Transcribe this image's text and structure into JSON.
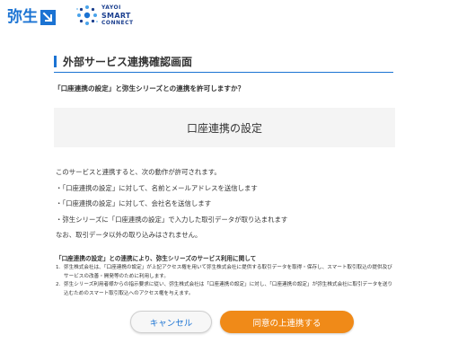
{
  "header": {
    "yayoi_logo_text": "弥生",
    "smart_connect": {
      "line1": "YAYOI",
      "line2": "SMART",
      "line3": "CONNECT"
    }
  },
  "page": {
    "title": "外部サービス連携確認画面",
    "question": "「口座連携の設定」と弥生シリーズとの連携を許可しますか？",
    "service_name": "口座連携の設定"
  },
  "description": [
    "このサービスと連携すると、次の動作が許可されます。",
    "・「口座連携の設定」に対して、名前とメールアドレスを送信します",
    "・「口座連携の設定」に対して、会社名を送信します",
    "・弥生シリーズに「口座連携の設定」で入力した取引データが取り込まれます",
    "なお、取引データ以外の取り込みはされません。"
  ],
  "notes": {
    "heading": "「口座連携の設定」との連携により、弥生シリーズのサービス利用に関して",
    "items": [
      {
        "num": "1.",
        "text": "弥生株式会社は、「口座連携の設定」が上記アクセス権を用いて弥生株式会社に提供する取引データを取得・保存し、スマート取引取込の提供及びサービスの改善・開発等のために利用します。"
      },
      {
        "num": "2.",
        "text": "弥生シリーズ利用者様からの指示要求に従い、弥生株式会社は「口座連携の設定」に対し、「口座連携の設定」が弥生株式会社に取引データを送り込むためのスマート取引取込へのアクセス権を与えます。"
      }
    ]
  },
  "buttons": {
    "cancel_label": "キャンセル",
    "agree_label": "同意の上連携する"
  },
  "colors": {
    "brand_blue": "#1b73d3",
    "accent_orange": "#f08a18"
  }
}
